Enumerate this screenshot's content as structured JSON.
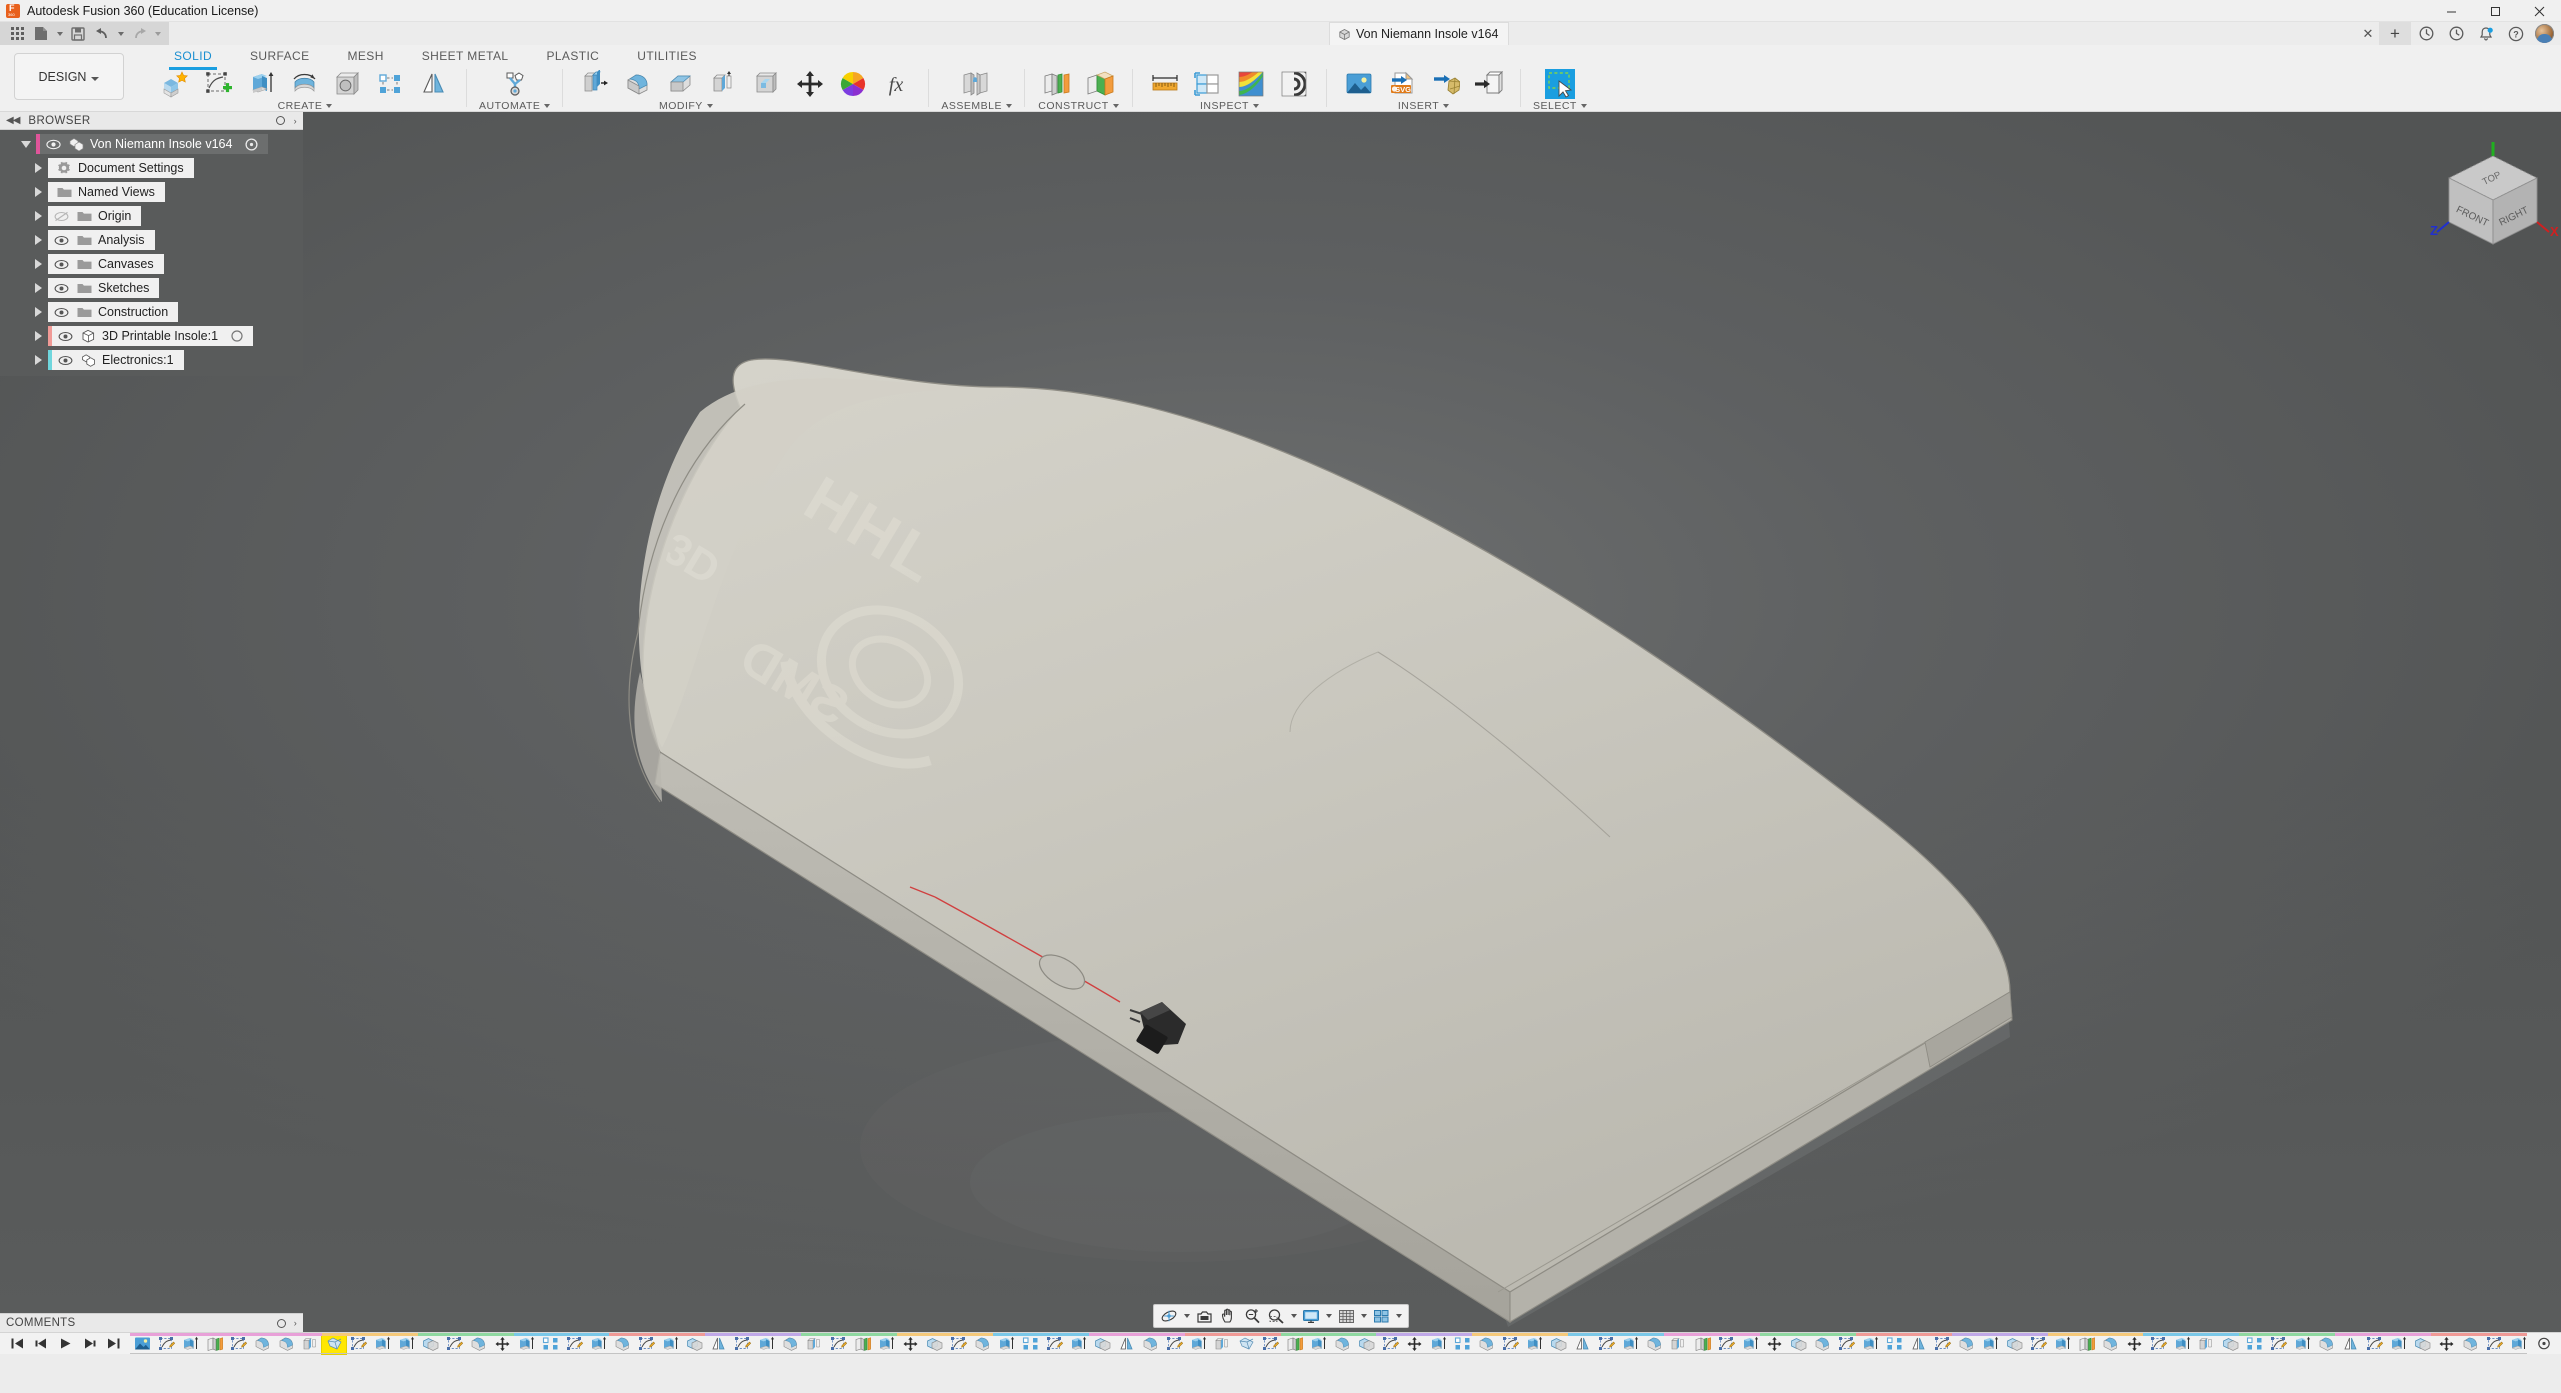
{
  "window": {
    "app_title": "Autodesk Fusion 360 (Education License)",
    "minimize": "—",
    "maximize": "▢",
    "close": "✕"
  },
  "quick_access": {
    "grid_menu": "app-grid",
    "new_label": "New",
    "save_label": "Save",
    "undo_label": "Undo",
    "redo_label": "Redo"
  },
  "document_tab": {
    "title": "Von Niemann Insole v164",
    "close": "✕",
    "new_tab": "+"
  },
  "system_icons": {
    "job_status": "job-status-icon",
    "recent": "recent-icon",
    "notifications": "bell-icon",
    "help": "help-icon",
    "profile": "avatar"
  },
  "workspace": {
    "selector_label": "DESIGN"
  },
  "ribbon": {
    "tabs": [
      {
        "label": "SOLID",
        "active": true
      },
      {
        "label": "SURFACE",
        "active": false
      },
      {
        "label": "MESH",
        "active": false
      },
      {
        "label": "SHEET METAL",
        "active": false
      },
      {
        "label": "PLASTIC",
        "active": false
      },
      {
        "label": "UTILITIES",
        "active": false
      }
    ],
    "groups": [
      {
        "label": "CREATE",
        "has_dropdown": true,
        "icons": [
          "new-component-icon",
          "create-sketch-icon",
          "extrude-icon",
          "revolve-icon",
          "hole-icon",
          "rectangular-pattern-icon",
          "mirror-icon"
        ]
      },
      {
        "label": "AUTOMATE",
        "has_dropdown": true,
        "icons": [
          "automate-icon"
        ]
      },
      {
        "label": "MODIFY",
        "has_dropdown": true,
        "icons": [
          "press-pull-icon",
          "fillet-icon",
          "chamfer-icon",
          "shell-icon",
          "draft-icon",
          "move-copy-icon",
          "appearance-icon",
          "change-parameters-icon"
        ]
      },
      {
        "label": "ASSEMBLE",
        "has_dropdown": true,
        "icons": [
          "joint-icon"
        ]
      },
      {
        "label": "CONSTRUCT",
        "has_dropdown": true,
        "icons": [
          "offset-plane-icon",
          "plane-at-angle-icon"
        ]
      },
      {
        "label": "INSPECT",
        "has_dropdown": true,
        "icons": [
          "measure-icon",
          "section-analysis-icon",
          "curvature-map-icon",
          "zebra-analysis-icon"
        ]
      },
      {
        "label": "INSERT",
        "has_dropdown": true,
        "icons": [
          "insert-canvas-icon",
          "insert-svg-icon",
          "insert-mesh-icon",
          "insert-derive-icon"
        ]
      },
      {
        "label": "SELECT",
        "has_dropdown": true,
        "icons": [
          "select-window-icon"
        ]
      }
    ]
  },
  "browser": {
    "panel_title": "BROWSER",
    "collapse_label": "◀◀",
    "tree": [
      {
        "label": "Von Niemann Insole v164",
        "icon": "assembly-icon",
        "visible": true,
        "selected": true,
        "indent": 0,
        "expanded": true,
        "strip": "#e0559a",
        "trailing": "scroll-indicator"
      },
      {
        "label": "Document Settings",
        "icon": "gear-icon",
        "visible": null,
        "selected": false,
        "indent": 1,
        "expanded": false,
        "strip": ""
      },
      {
        "label": "Named Views",
        "icon": "folder-icon",
        "visible": null,
        "selected": false,
        "indent": 1,
        "expanded": false,
        "strip": ""
      },
      {
        "label": "Origin",
        "icon": "folder-icon",
        "visible": false,
        "selected": false,
        "indent": 1,
        "expanded": false,
        "strip": ""
      },
      {
        "label": "Analysis",
        "icon": "folder-icon",
        "visible": true,
        "selected": false,
        "indent": 1,
        "expanded": false,
        "strip": ""
      },
      {
        "label": "Canvases",
        "icon": "folder-icon",
        "visible": true,
        "selected": false,
        "indent": 1,
        "expanded": false,
        "strip": ""
      },
      {
        "label": "Sketches",
        "icon": "folder-icon",
        "visible": true,
        "selected": false,
        "indent": 1,
        "expanded": false,
        "strip": ""
      },
      {
        "label": "Construction",
        "icon": "folder-icon",
        "visible": true,
        "selected": false,
        "indent": 1,
        "expanded": false,
        "strip": ""
      },
      {
        "label": "3D Printable Insole:1",
        "icon": "body-icon",
        "visible": true,
        "selected": false,
        "indent": 1,
        "expanded": false,
        "strip": "#f09a96",
        "trailing": "circle-outline"
      },
      {
        "label": "Electronics:1",
        "icon": "component-icon",
        "visible": true,
        "selected": false,
        "indent": 1,
        "expanded": false,
        "strip": "#6fd6dd"
      }
    ]
  },
  "comments": {
    "panel_title": "COMMENTS"
  },
  "viewcube": {
    "top_label": "TOP",
    "front_label": "FRONT",
    "right_label": "RIGHT",
    "axis_x": "X",
    "axis_z": "Z",
    "x_color": "#d02020",
    "z_color": "#2030d0",
    "y_color": "#20b020"
  },
  "navbar": {
    "buttons": [
      {
        "name": "orbit-icon",
        "dropdown": true
      },
      {
        "name": "look-at-icon",
        "dropdown": false
      },
      {
        "name": "pan-icon",
        "dropdown": false
      },
      {
        "name": "zoom-icon",
        "dropdown": false
      },
      {
        "name": "fit-icon",
        "dropdown": true
      },
      {
        "name": "display-settings-icon",
        "dropdown": true
      },
      {
        "name": "grid-snaps-icon",
        "dropdown": true
      },
      {
        "name": "viewports-icon",
        "dropdown": true
      }
    ]
  },
  "timeline": {
    "playback": [
      "go-to-beginning-icon",
      "step-back-icon",
      "play-icon",
      "step-forward-icon",
      "go-to-end-icon"
    ],
    "features": [
      "canvas-icon",
      "sketch-icon",
      "extrude-icon",
      "plane-icon",
      "sketch-icon",
      "fillet-icon",
      "fillet-icon",
      "shell-icon",
      "loft-icon",
      "sketch-icon",
      "extrude-icon",
      "extrude-icon",
      "combine-icon",
      "sketch-icon",
      "fillet-icon",
      "move-icon",
      "extrude-icon",
      "pattern-icon",
      "sketch-icon",
      "extrude-icon",
      "fillet-icon",
      "sketch-icon",
      "extrude-icon",
      "combine-icon",
      "mirror-icon",
      "sketch-icon",
      "extrude-icon",
      "fillet-icon",
      "shell-icon",
      "sketch-icon",
      "plane-icon",
      "extrude-icon",
      "move-icon",
      "combine-icon",
      "sketch-icon",
      "fillet-icon",
      "extrude-icon",
      "pattern-icon",
      "sketch-icon",
      "extrude-icon",
      "combine-icon",
      "mirror-icon",
      "fillet-icon",
      "sketch-icon",
      "extrude-icon",
      "shell-icon",
      "loft-icon",
      "sketch-icon",
      "plane-icon",
      "extrude-icon",
      "fillet-icon",
      "combine-icon",
      "sketch-icon",
      "move-icon",
      "extrude-icon",
      "pattern-icon",
      "fillet-icon",
      "sketch-icon",
      "extrude-icon",
      "combine-icon",
      "mirror-icon",
      "sketch-icon",
      "extrude-icon",
      "fillet-icon",
      "shell-icon",
      "plane-icon",
      "sketch-icon",
      "extrude-icon",
      "move-icon",
      "combine-icon",
      "fillet-icon",
      "sketch-icon",
      "extrude-icon",
      "pattern-icon",
      "mirror-icon",
      "sketch-icon",
      "fillet-icon",
      "extrude-icon",
      "combine-icon",
      "sketch-icon",
      "extrude-icon",
      "plane-icon",
      "fillet-icon",
      "move-icon",
      "sketch-icon",
      "extrude-icon",
      "shell-icon",
      "combine-icon",
      "pattern-icon",
      "sketch-icon",
      "extrude-icon",
      "fillet-icon",
      "mirror-icon",
      "sketch-icon",
      "extrude-icon",
      "combine-icon",
      "move-icon",
      "fillet-icon",
      "sketch-icon",
      "extrude-icon",
      "plane-icon",
      "component-icon"
    ],
    "highlighted_index": 8
  },
  "colors": {
    "accent": "#1a9ee0",
    "panel_bg": "#595b5b",
    "canvas_bg": "#5e6061",
    "ribbon_bg": "#f0f0f0",
    "model_body": "#cfcdc4"
  }
}
